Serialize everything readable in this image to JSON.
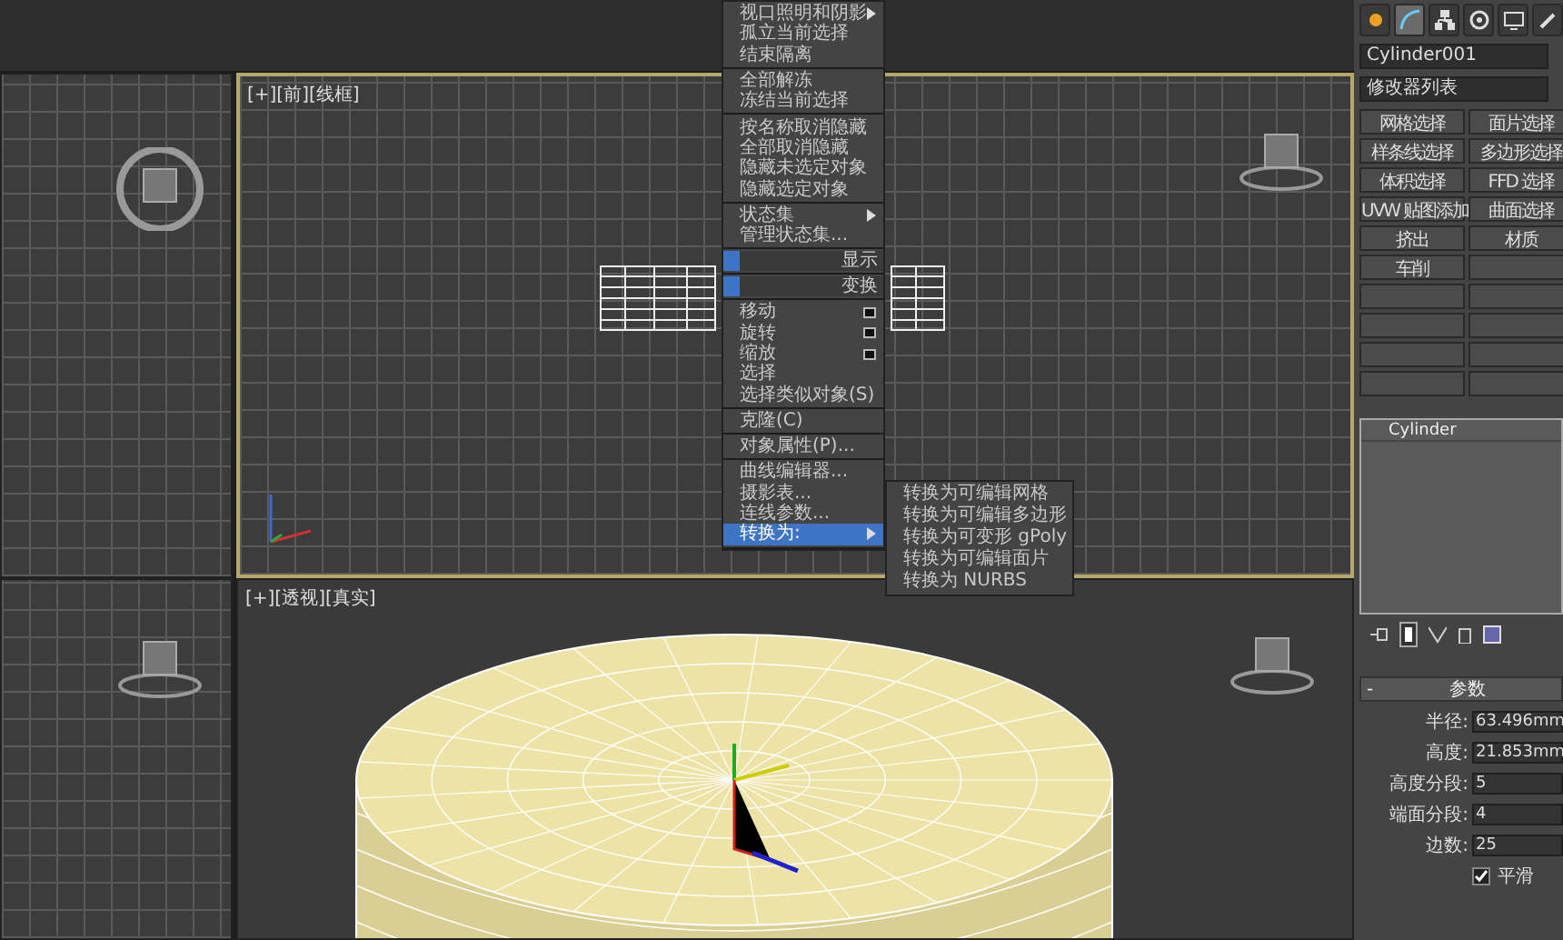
{
  "front_viewport": {
    "label": "[+][前][线框]"
  },
  "perspective_viewport": {
    "label": "[+][透视][真实]"
  },
  "quad_menu": {
    "sections": [
      {
        "items": [
          {
            "kind": "submenu",
            "label": "视口照明和阴影",
            "selected": false
          },
          {
            "kind": "item",
            "label": "孤立当前选择",
            "selected": false
          },
          {
            "kind": "item",
            "label": "结束隔离",
            "selected": false
          }
        ]
      },
      {
        "items": [
          {
            "kind": "item",
            "label": "全部解冻",
            "selected": false
          },
          {
            "kind": "item",
            "label": "冻结当前选择",
            "selected": false
          }
        ]
      },
      {
        "items": [
          {
            "kind": "item",
            "label": "按名称取消隐藏",
            "selected": false
          },
          {
            "kind": "item",
            "label": "全部取消隐藏",
            "selected": false
          },
          {
            "kind": "item",
            "label": "隐藏未选定对象",
            "selected": false
          },
          {
            "kind": "item",
            "label": "隐藏选定对象",
            "selected": false
          }
        ]
      },
      {
        "items": [
          {
            "kind": "submenu",
            "label": "状态集",
            "selected": false
          },
          {
            "kind": "item",
            "label": "管理状态集...",
            "selected": false
          }
        ]
      },
      {
        "items": [
          {
            "kind": "header",
            "label": "显示",
            "selected": false
          }
        ]
      },
      {
        "items": [
          {
            "kind": "header",
            "label": "变换",
            "selected": false
          }
        ]
      },
      {
        "items": [
          {
            "kind": "option",
            "label": "移动",
            "selected": false
          },
          {
            "kind": "option",
            "label": "旋转",
            "selected": false
          },
          {
            "kind": "option",
            "label": "缩放",
            "selected": false
          },
          {
            "kind": "item",
            "label": "选择",
            "selected": false
          },
          {
            "kind": "item",
            "label": "选择类似对象(S)",
            "selected": false
          }
        ]
      },
      {
        "items": [
          {
            "kind": "item",
            "label": "克隆(C)",
            "selected": false
          }
        ]
      },
      {
        "items": [
          {
            "kind": "item",
            "label": "对象属性(P)...",
            "selected": false
          }
        ]
      },
      {
        "items": [
          {
            "kind": "item",
            "label": "曲线编辑器...",
            "selected": false
          },
          {
            "kind": "item",
            "label": "摄影表...",
            "selected": false
          },
          {
            "kind": "item",
            "label": "连线参数...",
            "selected": false
          },
          {
            "kind": "submenu",
            "label": "转换为:",
            "selected": true
          }
        ]
      }
    ]
  },
  "submenu": {
    "items": [
      "转换为可编辑网格",
      "转换为可编辑多边形",
      "转换为可变形 gPoly",
      "转换为可编辑面片",
      "转换为 NURBS"
    ]
  },
  "command_panel": {
    "tabs": [
      {
        "kind": "create",
        "selected": false
      },
      {
        "kind": "modify",
        "selected": true
      },
      {
        "kind": "hierarchy",
        "selected": false
      },
      {
        "kind": "motion",
        "selected": false
      },
      {
        "kind": "display",
        "selected": false
      },
      {
        "kind": "utilities",
        "selected": false
      }
    ],
    "object_name": "Cylinder001",
    "modifier_list": "修改器列表",
    "modifier_buttons": [
      "网格选择",
      "面片选择",
      "样条线选择",
      "多边形选择",
      "体积选择",
      "FFD 选择",
      "UVW 贴图添加",
      "曲面选择",
      "挤出",
      "材质",
      "车削"
    ],
    "stack": [
      "Cylinder"
    ],
    "parameters": {
      "title": "参数",
      "collapse": "-",
      "fields": [
        {
          "label": "半径:",
          "value": "63.496mm"
        },
        {
          "label": "高度:",
          "value": "21.853mm"
        },
        {
          "label": "高度分段:",
          "value": "5"
        },
        {
          "label": "端面分段:",
          "value": "4"
        },
        {
          "label": "边数:",
          "value": "25"
        }
      ],
      "smooth": {
        "label": "平滑",
        "checked": true
      }
    }
  }
}
